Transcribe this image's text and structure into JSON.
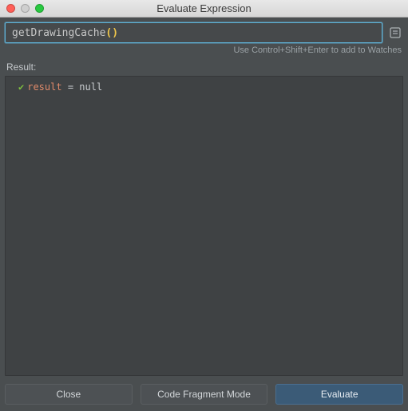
{
  "window": {
    "title": "Evaluate Expression"
  },
  "expression": {
    "function": "getDrawingCache",
    "parens": "()",
    "hint": "Use Control+Shift+Enter to add to Watches"
  },
  "result": {
    "label": "Result:",
    "name": "result",
    "rest": " = null"
  },
  "buttons": {
    "close": "Close",
    "codeFragment": "Code Fragment Mode",
    "evaluate": "Evaluate"
  }
}
